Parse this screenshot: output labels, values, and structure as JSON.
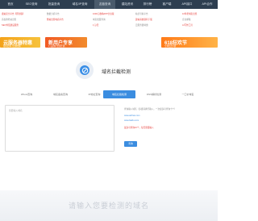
{
  "nav": {
    "items": [
      {
        "label": "首页"
      },
      {
        "label": "SEO查询"
      },
      {
        "label": "批量查询"
      },
      {
        "label": "域名/IP查询"
      },
      {
        "label": "友链查询"
      },
      {
        "label": "建站资讯"
      },
      {
        "label": "排行榜"
      },
      {
        "label": "客户端"
      },
      {
        "label": "API接口"
      },
      {
        "label": "API合作"
      }
    ]
  },
  "ad_links": [
    {
      "text": "盛站安全平台【原创版】",
      "color": "red"
    },
    {
      "text": "数据分析平台",
      "color": "gray"
    },
    {
      "text": "1000元收购APP企业版",
      "color": "red"
    },
    {
      "text": "站长导航平台",
      "color": "gray"
    },
    {
      "text": "10年老域名出售",
      "color": "red"
    },
    {
      "text": "高权重老站出售",
      "color": "gray"
    },
    {
      "text": "整站出售电商平台",
      "color": "red"
    },
    {
      "text": "域名批量查询",
      "color": "gray"
    },
    {
      "text": "建站系统源码下载",
      "color": "red"
    },
    {
      "text": "企业邮箱",
      "color": "gray"
    },
    {
      "text": "SEO外链建设服务",
      "color": "red"
    },
    {
      "text": "1元/天",
      "color": "red"
    },
    {
      "text": "云服务器特惠",
      "color": "gray"
    },
    {
      "text": "AI写作工具",
      "color": "red"
    }
  ],
  "banners": {
    "left": {
      "title": "云服务器特惠",
      "sub": "限时秒杀 立即抢购"
    },
    "mid": {
      "title": "新用户专享",
      "sub": "1元起购 立即开通"
    },
    "right": {
      "title": "618狂欢节",
      "sub": "全场低至1折"
    }
  },
  "tool": {
    "title": "域名拦截检测"
  },
  "tabs": [
    {
      "label": "Whois查询"
    },
    {
      "label": "域名备案查询"
    },
    {
      "label": "IP地址查询"
    },
    {
      "label": "域名拦截检测"
    },
    {
      "label": "DNS解析检测"
    },
    {
      "label": "一口价域名"
    }
  ],
  "form": {
    "placeholder": "您要输入域名",
    "hint1": "查询输入域名（多组请换行输入，一次最多可查询十个）",
    "hint2": "www.aizhan.com",
    "hint3": "www.baidu.com",
    "hint4": "最多可查询10个，每天限量输入",
    "button": "查询"
  },
  "bottom": {
    "placeholder": "请输入您要检测的域名"
  }
}
